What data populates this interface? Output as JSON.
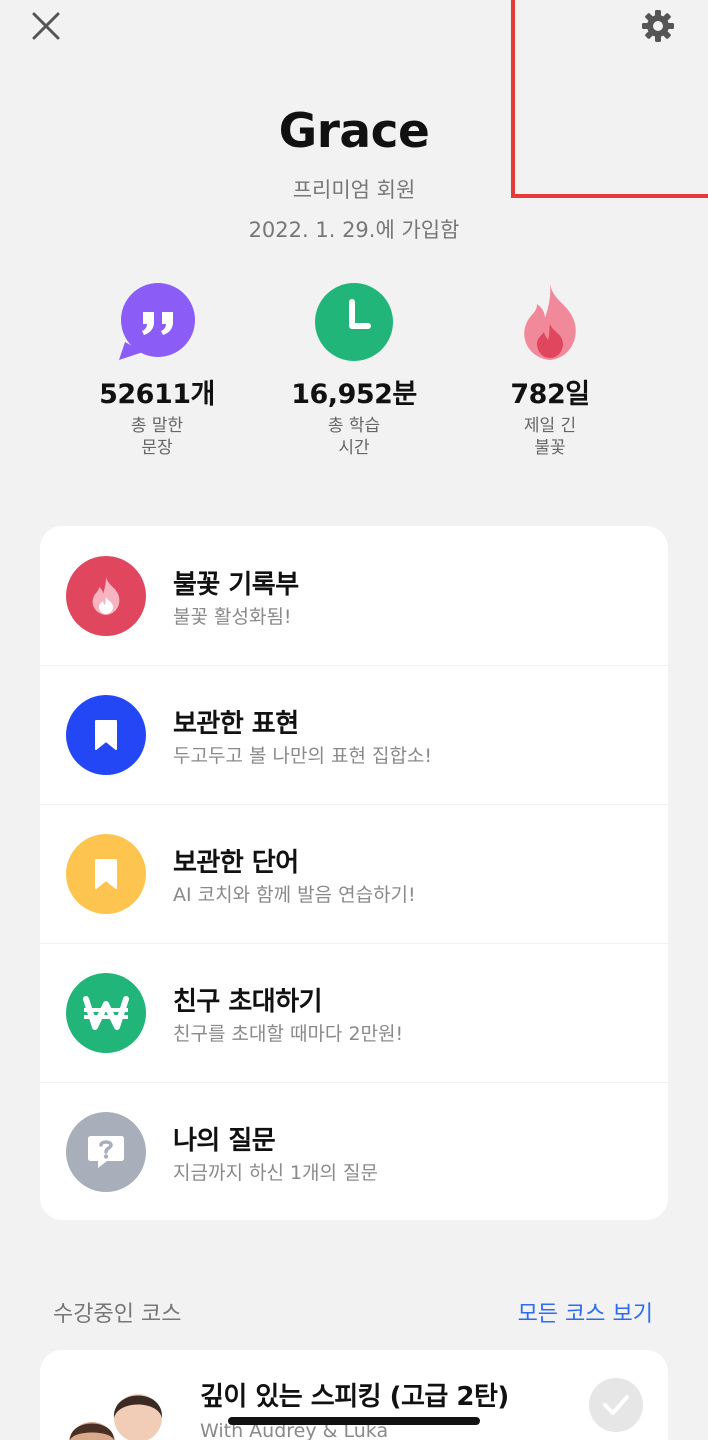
{
  "profile": {
    "name": "Grace",
    "tier": "프리미엄 회원",
    "joined": "2022. 1. 29.에 가입함"
  },
  "stats": [
    {
      "value": "52611개",
      "label_line1": "총 말한",
      "label_line2": "문장",
      "icon": "quote-bubble-icon",
      "color": "#8b5cf6"
    },
    {
      "value": "16,952분",
      "label_line1": "총 학습",
      "label_line2": "시간",
      "icon": "clock-icon",
      "color": "#22b57a"
    },
    {
      "value": "782일",
      "label_line1": "제일 긴",
      "label_line2": "불꽃",
      "icon": "flame-icon",
      "color": "#f08a9a"
    }
  ],
  "menu": [
    {
      "title": "불꽃 기록부",
      "subtitle": "불꽃 활성화됨!",
      "icon": "flame-icon",
      "color": "#e0475f"
    },
    {
      "title": "보관한 표현",
      "subtitle": "두고두고 볼 나만의 표현 집합소!",
      "icon": "bookmark-icon",
      "color": "#2447f5"
    },
    {
      "title": "보관한 단어",
      "subtitle": "AI 코치와 함께 발음 연습하기!",
      "icon": "bookmark-icon",
      "color": "#fdc44f"
    },
    {
      "title": "친구 초대하기",
      "subtitle": "친구를 초대할 때마다 2만원!",
      "icon": "won-icon",
      "color": "#22b57a"
    },
    {
      "title": "나의 질문",
      "subtitle": "지금까지 하신 1개의 질문",
      "icon": "question-bubble-icon",
      "color": "#a8afbb"
    }
  ],
  "courses_section": {
    "title": "수강중인 코스",
    "view_all": "모든 코스 보기"
  },
  "course": {
    "title": "깊이 있는 스피킹 (고급 2탄)",
    "subtitle": "With Audrey & Luka"
  },
  "colors": {
    "background": "#f2f2f2",
    "accent_link": "#2d6cf0",
    "highlight": "#e8393a"
  }
}
